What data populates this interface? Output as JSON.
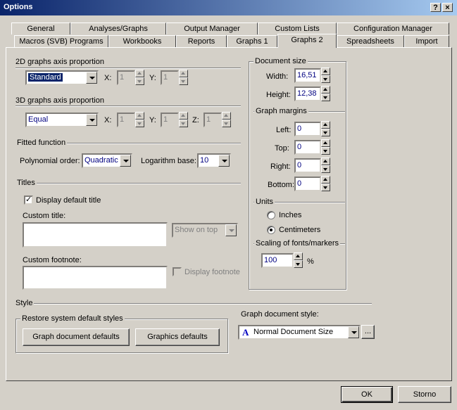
{
  "window": {
    "title": "Options",
    "help_btn": "?",
    "close_btn": "×"
  },
  "tabs_row1": [
    "General",
    "Analyses/Graphs",
    "Output Manager",
    "Custom Lists",
    "Configuration Manager"
  ],
  "tabs_row2": [
    "Macros (SVB) Programs",
    "Workbooks",
    "Reports",
    "Graphs 1",
    "Graphs 2",
    "Spreadsheets",
    "Import"
  ],
  "axis2d": {
    "label": "2D graphs axis proportion",
    "value": "Standard",
    "x_label": "X:",
    "x_value": "1",
    "y_label": "Y:",
    "y_value": "1"
  },
  "axis3d": {
    "label": "3D graphs axis proportion",
    "value": "Equal",
    "x_label": "X:",
    "x_value": "1",
    "y_label": "Y:",
    "y_value": "1",
    "z_label": "Z:",
    "z_value": "1"
  },
  "fitted": {
    "label": "Fitted function",
    "poly_label": "Polynomial order:",
    "poly_value": "Quadratic",
    "log_label": "Logarithm base:",
    "log_value": "10"
  },
  "titles": {
    "label": "Titles",
    "display_default": "Display default title",
    "custom_title": "Custom title:",
    "show_on_top": "Show on top",
    "custom_footnote": "Custom footnote:",
    "display_footnote": "Display footnote"
  },
  "docsize": {
    "label": "Document size",
    "width_label": "Width:",
    "width_value": "16,51",
    "height_label": "Height:",
    "height_value": "12,38"
  },
  "margins": {
    "label": "Graph margins",
    "left_label": "Left:",
    "left_value": "0",
    "top_label": "Top:",
    "top_value": "0",
    "right_label": "Right:",
    "right_value": "0",
    "bottom_label": "Bottom:",
    "bottom_value": "0"
  },
  "units": {
    "label": "Units",
    "inches": "Inches",
    "centimeters": "Centimeters",
    "selected": "Centimeters"
  },
  "scaling": {
    "label": "Scaling of fonts/markers",
    "value": "100",
    "unit": "%"
  },
  "style": {
    "label": "Style",
    "restore_label": "Restore system default styles",
    "graph_defaults": "Graph document defaults",
    "graphics_defaults": "Graphics defaults",
    "doc_style_label": "Graph document style:",
    "doc_style_value": "Normal Document Size",
    "doc_style_icon": "A",
    "browse": "..."
  },
  "footer": {
    "ok": "OK",
    "cancel": "Storno"
  }
}
